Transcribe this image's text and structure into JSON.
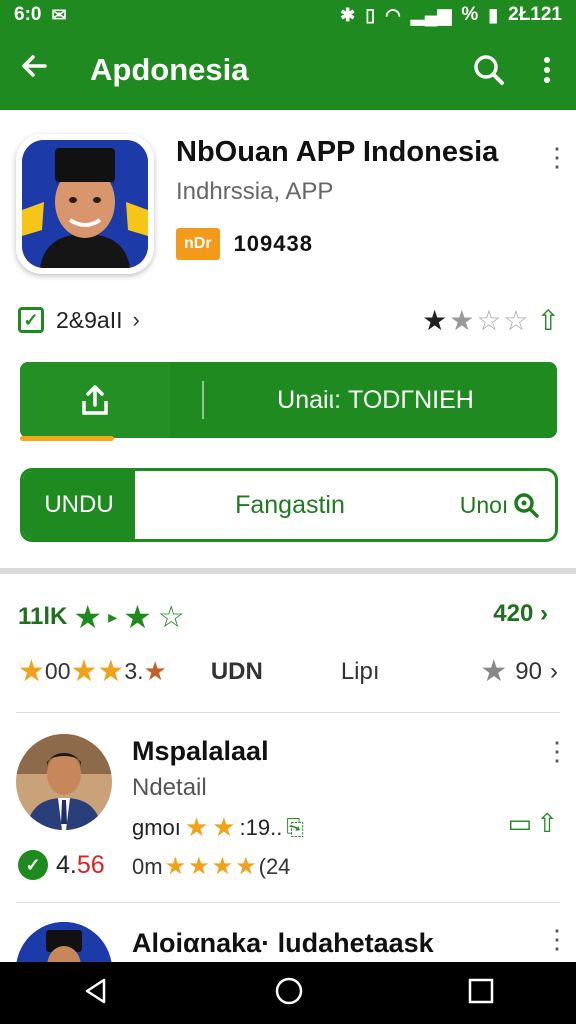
{
  "statusbar": {
    "time_left": "6:0",
    "clock": "2Ł121",
    "battery_text": "%"
  },
  "appbar": {
    "title": "Apdonesia"
  },
  "app": {
    "name": "NbOuan APP Indonesia",
    "subtitle": "Indhrssia, APP",
    "badge": "nDr",
    "count": "109438",
    "meta_text": "2&9aII",
    "rating_stars": 1.5
  },
  "primary_button": {
    "label": "Unaiι: TODΓNIEH",
    "progress": 0.2
  },
  "segmented": {
    "left": "UNDU",
    "middle": "Fangastin",
    "right": "Unoı"
  },
  "ratings": {
    "row1_value": "11lK",
    "row1_right": "420",
    "row2_value1": "00",
    "row2_value2": "3.",
    "row2_label1": "UDN",
    "row2_label2": "Lipı",
    "row2_right": "90"
  },
  "reviews": [
    {
      "name": "Mspalalaal",
      "subtitle": "Ndetail",
      "line1_prefix": "gmoı",
      "line1_value": ":19..",
      "score": "4.",
      "score_red": "56",
      "line2_prefix": "0m",
      "line2_suffix": "(24"
    },
    {
      "name": "Aloiαnaka· ludahetaask"
    }
  ],
  "colors": {
    "primary": "#1f8a1f",
    "accent": "#f39a1b",
    "star_yellow": "#f0a31a"
  }
}
